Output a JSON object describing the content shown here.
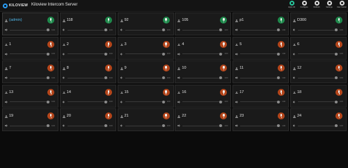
{
  "header": {
    "logo_text": "KILOVIEW",
    "title": "Kiloview Intercom Server",
    "actions": [
      {
        "label": "Apply All",
        "icon": "apply-all-icon",
        "active": true
      },
      {
        "label": "Configure",
        "icon": "configure-icon",
        "active": false
      },
      {
        "label": "Refresh",
        "icon": "refresh-icon",
        "active": false
      },
      {
        "label": "Settings",
        "icon": "settings-icon",
        "active": false
      },
      {
        "label": "User Center",
        "icon": "user-center-icon",
        "active": false
      }
    ]
  },
  "tiles": [
    {
      "name": "(admin)",
      "self": true,
      "mic": "green",
      "volume": "100",
      "volume_level": 0.95
    },
    {
      "name": "118",
      "self": false,
      "mic": "green",
      "volume": "100",
      "volume_level": 0.95
    },
    {
      "name": "92",
      "self": false,
      "mic": "green",
      "volume": "100",
      "volume_level": 0.95
    },
    {
      "name": "105",
      "self": false,
      "mic": "green",
      "volume": "100",
      "volume_level": 0.95
    },
    {
      "name": "p1",
      "self": false,
      "mic": "green",
      "volume": "100",
      "volume_level": 0.95
    },
    {
      "name": "D300",
      "self": false,
      "mic": "green",
      "volume": "100",
      "volume_level": 0.95
    },
    {
      "name": "1",
      "self": false,
      "mic": "orange",
      "volume": "100",
      "volume_level": 0.95
    },
    {
      "name": "2",
      "self": false,
      "mic": "orange",
      "volume": "100",
      "volume_level": 0.95
    },
    {
      "name": "3",
      "self": false,
      "mic": "orange",
      "volume": "100",
      "volume_level": 0.95
    },
    {
      "name": "4",
      "self": false,
      "mic": "orange",
      "volume": "100",
      "volume_level": 0.95
    },
    {
      "name": "5",
      "self": false,
      "mic": "orange",
      "volume": "100",
      "volume_level": 0.95
    },
    {
      "name": "6",
      "self": false,
      "mic": "orange",
      "volume": "100",
      "volume_level": 0.95
    },
    {
      "name": "7",
      "self": false,
      "mic": "orange",
      "volume": "100",
      "volume_level": 0.95
    },
    {
      "name": "8",
      "self": false,
      "mic": "orange",
      "volume": "100",
      "volume_level": 0.95
    },
    {
      "name": "9",
      "self": false,
      "mic": "orange",
      "volume": "100",
      "volume_level": 0.95
    },
    {
      "name": "10",
      "self": false,
      "mic": "orange",
      "volume": "100",
      "volume_level": 0.95
    },
    {
      "name": "11",
      "self": false,
      "mic": "orange",
      "volume": "100",
      "volume_level": 0.95
    },
    {
      "name": "12",
      "self": false,
      "mic": "orange",
      "volume": "100",
      "volume_level": 0.95
    },
    {
      "name": "13",
      "self": false,
      "mic": "orange",
      "volume": "100",
      "volume_level": 0.95
    },
    {
      "name": "14",
      "self": false,
      "mic": "orange",
      "volume": "100",
      "volume_level": 0.95
    },
    {
      "name": "15",
      "self": false,
      "mic": "orange",
      "volume": "100",
      "volume_level": 0.95
    },
    {
      "name": "16",
      "self": false,
      "mic": "orange",
      "volume": "100",
      "volume_level": 0.95
    },
    {
      "name": "17",
      "self": false,
      "mic": "orange",
      "volume": "100",
      "volume_level": 0.95
    },
    {
      "name": "18",
      "self": false,
      "mic": "orange",
      "volume": "100",
      "volume_level": 0.95
    },
    {
      "name": "19",
      "self": false,
      "mic": "orange",
      "volume": "100",
      "volume_level": 0.95
    },
    {
      "name": "20",
      "self": false,
      "mic": "orange",
      "volume": "100",
      "volume_level": 0.95
    },
    {
      "name": "21",
      "self": false,
      "mic": "orange",
      "volume": "100",
      "volume_level": 0.95
    },
    {
      "name": "22",
      "self": false,
      "mic": "orange",
      "volume": "100",
      "volume_level": 0.95
    },
    {
      "name": "23",
      "self": false,
      "mic": "orange",
      "volume": "100",
      "volume_level": 0.95
    },
    {
      "name": "24",
      "self": false,
      "mic": "orange",
      "volume": "100",
      "volume_level": 0.95
    }
  ],
  "colors": {
    "mic_on": "#1f8a4c",
    "mic_off": "#b5461b",
    "self_name": "#4fb7e8",
    "background": "#0b0b0b"
  }
}
